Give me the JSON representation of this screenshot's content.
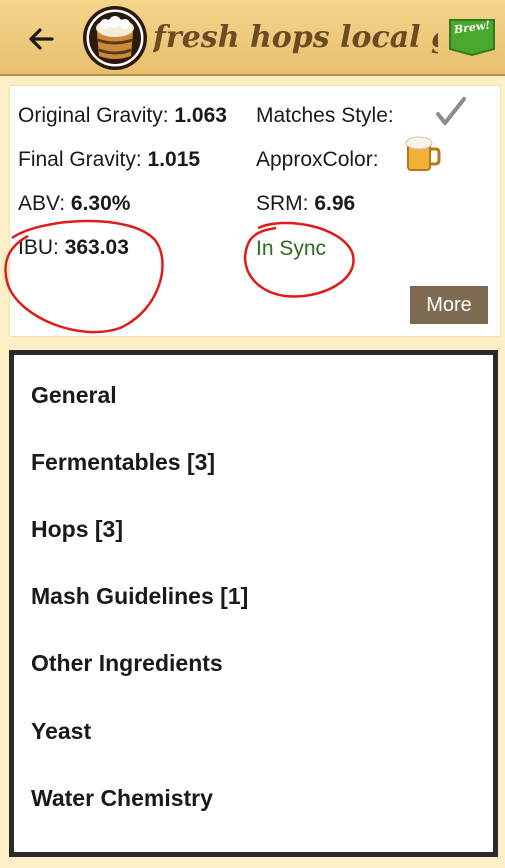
{
  "header": {
    "title": "fresh hops local gra...",
    "brew_label": "Brew!"
  },
  "stats": {
    "og_label": "Original Gravity: ",
    "og_value": "1.063",
    "fg_label": "Final Gravity: ",
    "fg_value": "1.015",
    "abv_label": "ABV: ",
    "abv_value": "6.30%",
    "ibu_label": "IBU: ",
    "ibu_value": "363.03",
    "style_label": "Matches Style:",
    "color_label": "ApproxColor:",
    "srm_label": "SRM: ",
    "srm_value": "6.96",
    "sync_status": "In Sync",
    "more_label": "More"
  },
  "sections": [
    "General",
    "Fermentables [3]",
    "Hops [3]",
    "Mash Guidelines [1]",
    "Other Ingredients",
    "Yeast",
    "Water Chemistry"
  ],
  "colors": {
    "header_bg": "#f4d58a",
    "title_text": "#6b4a24",
    "brew_button": "#4aa82e",
    "sync_text": "#2e6b23",
    "more_button": "#7d6a51",
    "annotation": "#e01b1b"
  },
  "icons": {
    "back": "back-arrow-icon",
    "logo": "beer-barrel-logo-icon",
    "brew": "brew-icon",
    "style_match": "check-icon",
    "color": "beer-mug-icon"
  }
}
